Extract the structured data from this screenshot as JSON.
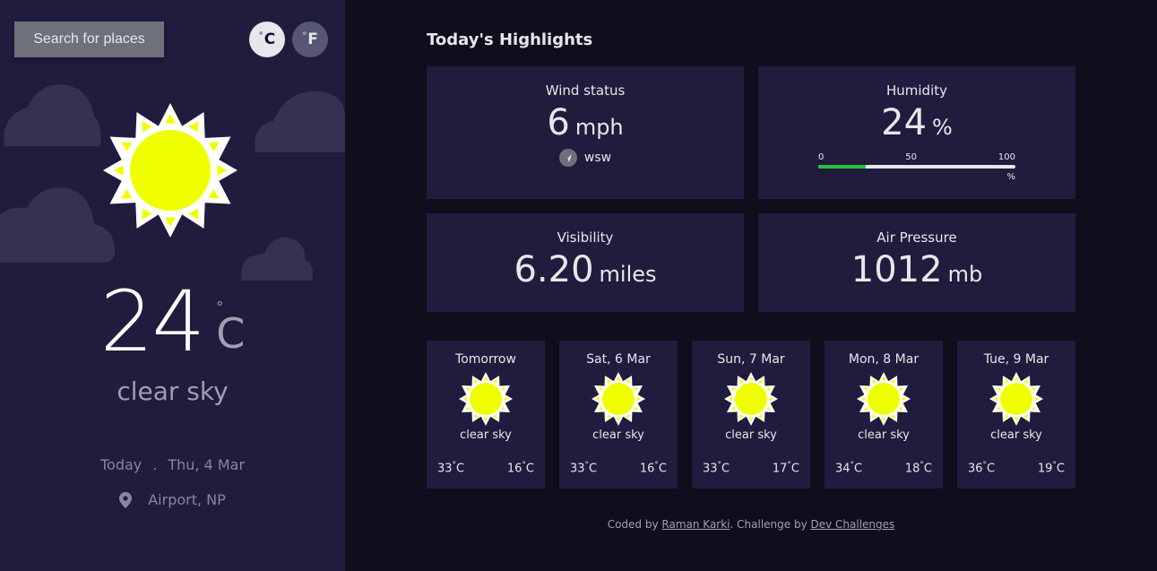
{
  "sidebar": {
    "search_label": "Search for places",
    "unit_c": "C",
    "unit_f": "F",
    "degree": "°",
    "current_temp": "24",
    "current_unit": "C",
    "condition": "clear sky",
    "date_today": "Today",
    "date_sep": ".",
    "date_value": "Thu, 4 Mar",
    "location": "Airport, NP",
    "location_icon": "location-pin-icon",
    "weather_icon": "sun-icon"
  },
  "highlights": {
    "title": "Today's Highlights",
    "wind": {
      "label": "Wind status",
      "value": "6",
      "unit": "mph",
      "direction": "wsw"
    },
    "humidity": {
      "label": "Humidity",
      "value": "24",
      "unit": "%",
      "scale_min": "0",
      "scale_mid": "50",
      "scale_max": "100",
      "scale_unit": "%",
      "level": 0.24
    },
    "visibility": {
      "label": "Visibility",
      "value": "6.20",
      "unit": "miles"
    },
    "pressure": {
      "label": "Air Pressure",
      "value": "1012",
      "unit": "mb"
    }
  },
  "forecast": [
    {
      "day": "Tomorrow",
      "cond": "clear sky",
      "max": "33",
      "min": "16",
      "unit": "C"
    },
    {
      "day": "Sat, 6 Mar",
      "cond": "clear sky",
      "max": "33",
      "min": "16",
      "unit": "C"
    },
    {
      "day": "Sun, 7 Mar",
      "cond": "clear sky",
      "max": "33",
      "min": "17",
      "unit": "C"
    },
    {
      "day": "Mon, 8 Mar",
      "cond": "clear sky",
      "max": "34",
      "min": "18",
      "unit": "C"
    },
    {
      "day": "Tue, 9 Mar",
      "cond": "clear sky",
      "max": "36",
      "min": "19",
      "unit": "C"
    }
  ],
  "footer": {
    "prefix": "Coded by",
    "author": "Raman Karki",
    "middle": ". Challenge by",
    "challenge": "Dev Challenges"
  },
  "colors": {
    "sidebar_bg": "#211b3d",
    "page_bg": "#100e1d",
    "card_bg": "#211b3d",
    "sun_yellow": "#f0ff00",
    "humidity_fill": "#1fc53a"
  }
}
